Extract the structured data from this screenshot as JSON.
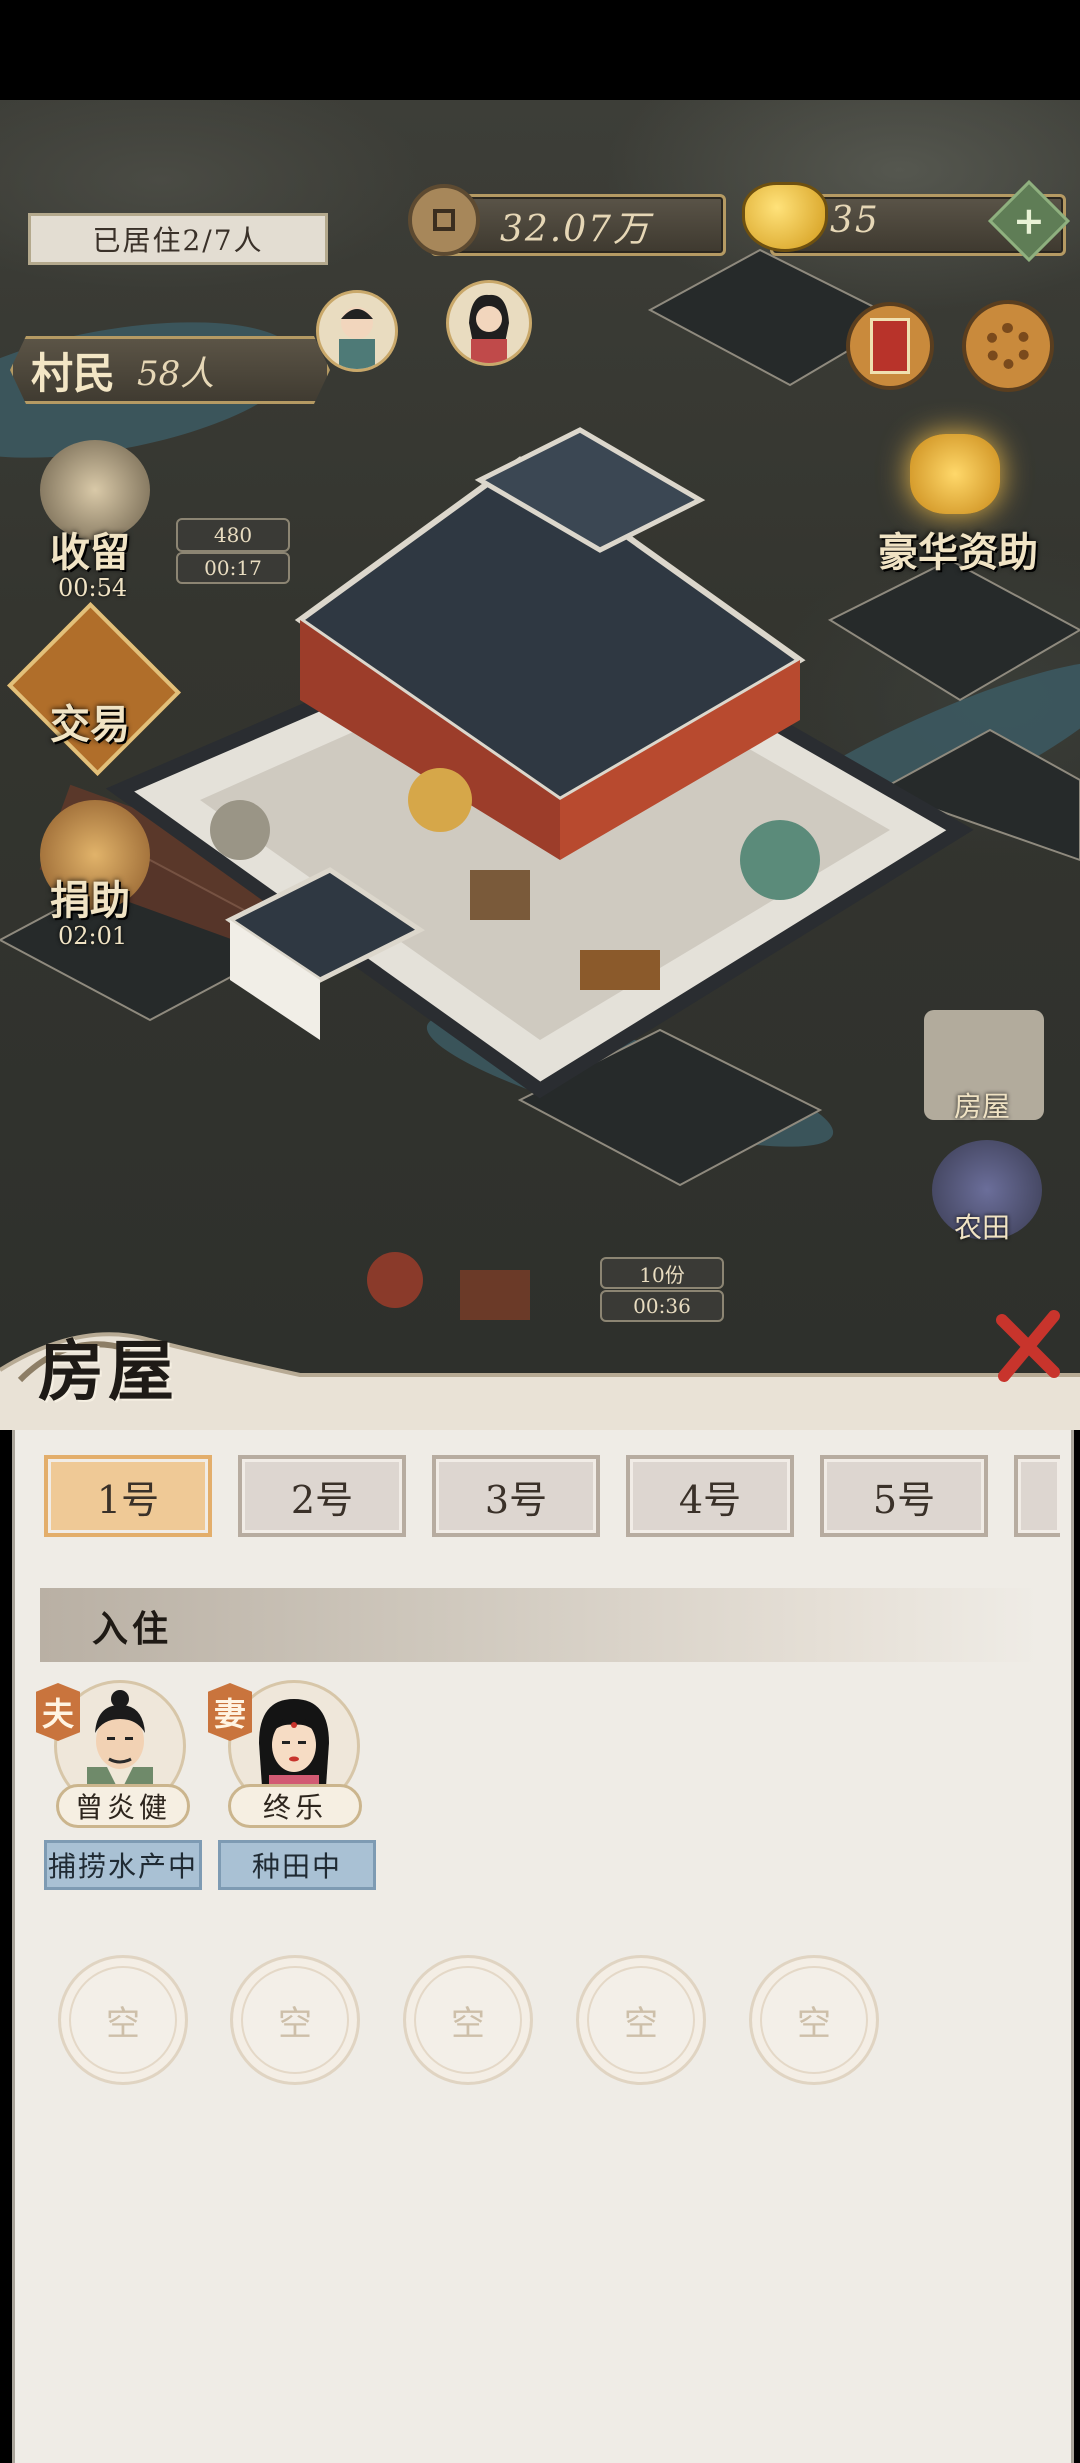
{
  "hud": {
    "residents_label": "已居住2/7人",
    "coins": "32.07万",
    "gold": "35",
    "villagers_label": "村民",
    "villagers_count": "58人"
  },
  "left_menu": {
    "shelter": {
      "label": "收留",
      "timer": "00:54"
    },
    "trade": {
      "label": "交易"
    },
    "donate": {
      "label": "捐助",
      "timer": "02:01"
    },
    "mini_badge_value": "480",
    "mini_badge_timer": "00:17"
  },
  "right_menu": {
    "luxury": "豪华资助",
    "house": "房屋",
    "farmland": "农田"
  },
  "map_badges": {
    "stock": "10份",
    "timer": "00:36"
  },
  "panel": {
    "title": "房屋",
    "tabs": [
      "1号",
      "2号",
      "3号",
      "4号",
      "5号"
    ],
    "section_title": "入住",
    "residents": [
      {
        "role": "夫",
        "name": "曾炎健",
        "status": "捕捞水产中"
      },
      {
        "role": "妻",
        "name": "终乐",
        "status": "种田中"
      }
    ],
    "empty_slots": [
      "空",
      "空",
      "空",
      "空",
      "空"
    ]
  }
}
